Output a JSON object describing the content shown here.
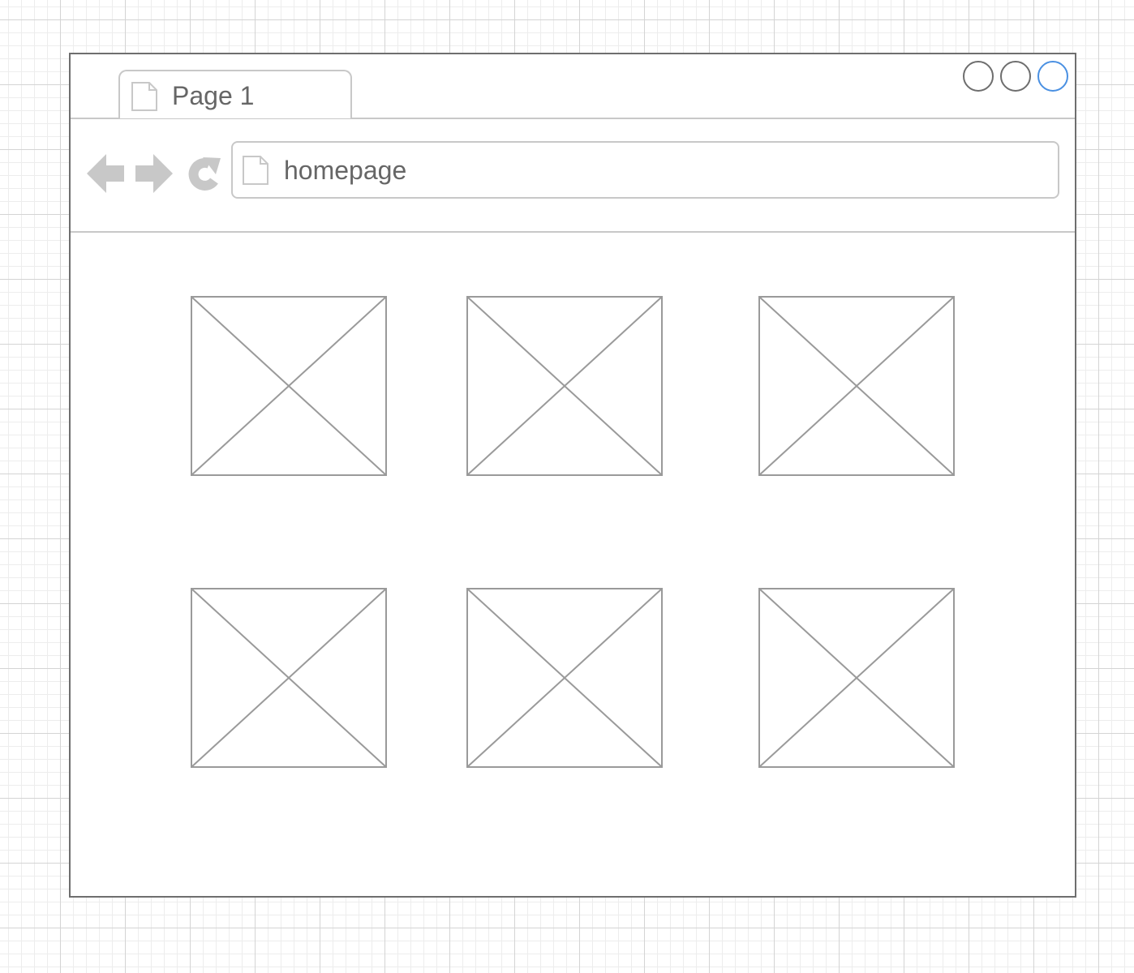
{
  "browser": {
    "tab": {
      "label": "Page 1",
      "icon": "page-icon"
    },
    "window_controls": [
      {
        "name": "minimize",
        "color": "#6e6e6e"
      },
      {
        "name": "maximize",
        "color": "#6e6e6e"
      },
      {
        "name": "close",
        "color": "#4a90e2"
      }
    ],
    "nav": {
      "back_icon": "arrow-left-icon",
      "forward_icon": "arrow-right-icon",
      "reload_icon": "reload-icon"
    },
    "address_bar": {
      "value": "homepage",
      "icon": "page-icon"
    }
  },
  "content": {
    "placeholders": [
      {
        "type": "image-placeholder"
      },
      {
        "type": "image-placeholder"
      },
      {
        "type": "image-placeholder"
      },
      {
        "type": "image-placeholder"
      },
      {
        "type": "image-placeholder"
      },
      {
        "type": "image-placeholder"
      }
    ]
  },
  "colors": {
    "frame": "#6e6e6e",
    "line": "#c8c8c8",
    "placeholder": "#9a9a9a",
    "text": "#666666",
    "icon": "#c8c8c8",
    "accent": "#4a90e2"
  }
}
